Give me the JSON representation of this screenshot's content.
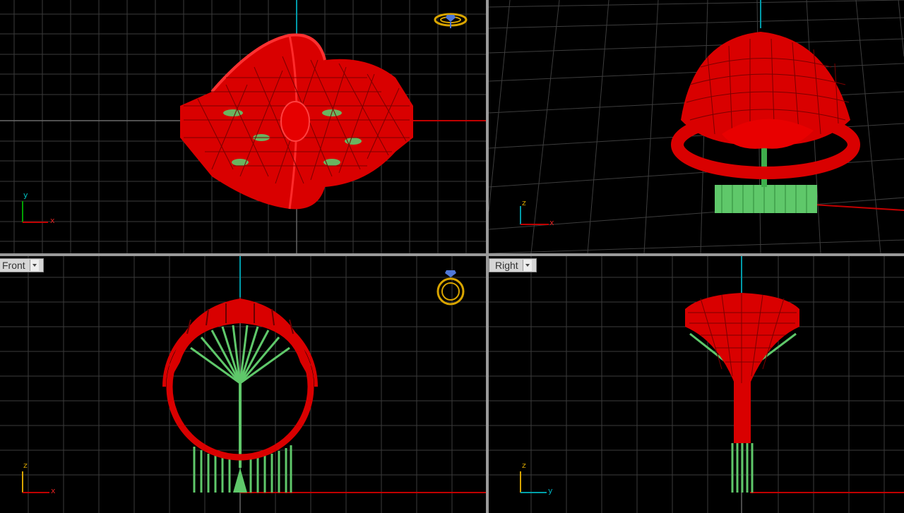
{
  "viewports": {
    "top": {
      "label": "",
      "axis_a": "y",
      "axis_b": "x"
    },
    "perspective": {
      "label": "",
      "axis_a": "z",
      "axis_b": "x"
    },
    "front": {
      "label": "Front",
      "axis_a": "z",
      "axis_b": "x"
    },
    "right": {
      "label": "Right",
      "axis_a": "z",
      "axis_b": "y"
    }
  },
  "colors": {
    "grid": "#3a3a3a",
    "grid_major": "#5a5a5a",
    "model": "#e40000",
    "support": "#5fc86a",
    "axis_x": "#c00000",
    "axis_y": "#00a000",
    "axis_z": "#009aa8",
    "gizmo": "#d8a400"
  },
  "icons": [
    "ring-gizmo-icon",
    "dropdown-chevron-icon"
  ]
}
